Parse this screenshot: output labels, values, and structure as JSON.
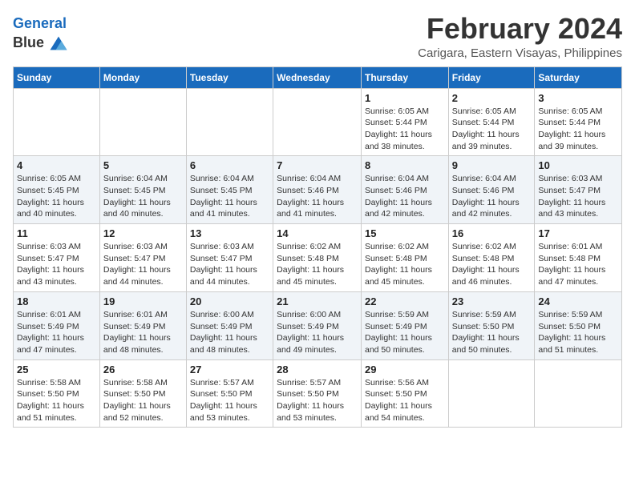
{
  "header": {
    "logo_line1": "General",
    "logo_line2": "Blue",
    "month": "February 2024",
    "location": "Carigara, Eastern Visayas, Philippines"
  },
  "weekdays": [
    "Sunday",
    "Monday",
    "Tuesday",
    "Wednesday",
    "Thursday",
    "Friday",
    "Saturday"
  ],
  "weeks": [
    [
      {
        "day": "",
        "info": ""
      },
      {
        "day": "",
        "info": ""
      },
      {
        "day": "",
        "info": ""
      },
      {
        "day": "",
        "info": ""
      },
      {
        "day": "1",
        "info": "Sunrise: 6:05 AM\nSunset: 5:44 PM\nDaylight: 11 hours\nand 38 minutes."
      },
      {
        "day": "2",
        "info": "Sunrise: 6:05 AM\nSunset: 5:44 PM\nDaylight: 11 hours\nand 39 minutes."
      },
      {
        "day": "3",
        "info": "Sunrise: 6:05 AM\nSunset: 5:44 PM\nDaylight: 11 hours\nand 39 minutes."
      }
    ],
    [
      {
        "day": "4",
        "info": "Sunrise: 6:05 AM\nSunset: 5:45 PM\nDaylight: 11 hours\nand 40 minutes."
      },
      {
        "day": "5",
        "info": "Sunrise: 6:04 AM\nSunset: 5:45 PM\nDaylight: 11 hours\nand 40 minutes."
      },
      {
        "day": "6",
        "info": "Sunrise: 6:04 AM\nSunset: 5:45 PM\nDaylight: 11 hours\nand 41 minutes."
      },
      {
        "day": "7",
        "info": "Sunrise: 6:04 AM\nSunset: 5:46 PM\nDaylight: 11 hours\nand 41 minutes."
      },
      {
        "day": "8",
        "info": "Sunrise: 6:04 AM\nSunset: 5:46 PM\nDaylight: 11 hours\nand 42 minutes."
      },
      {
        "day": "9",
        "info": "Sunrise: 6:04 AM\nSunset: 5:46 PM\nDaylight: 11 hours\nand 42 minutes."
      },
      {
        "day": "10",
        "info": "Sunrise: 6:03 AM\nSunset: 5:47 PM\nDaylight: 11 hours\nand 43 minutes."
      }
    ],
    [
      {
        "day": "11",
        "info": "Sunrise: 6:03 AM\nSunset: 5:47 PM\nDaylight: 11 hours\nand 43 minutes."
      },
      {
        "day": "12",
        "info": "Sunrise: 6:03 AM\nSunset: 5:47 PM\nDaylight: 11 hours\nand 44 minutes."
      },
      {
        "day": "13",
        "info": "Sunrise: 6:03 AM\nSunset: 5:47 PM\nDaylight: 11 hours\nand 44 minutes."
      },
      {
        "day": "14",
        "info": "Sunrise: 6:02 AM\nSunset: 5:48 PM\nDaylight: 11 hours\nand 45 minutes."
      },
      {
        "day": "15",
        "info": "Sunrise: 6:02 AM\nSunset: 5:48 PM\nDaylight: 11 hours\nand 45 minutes."
      },
      {
        "day": "16",
        "info": "Sunrise: 6:02 AM\nSunset: 5:48 PM\nDaylight: 11 hours\nand 46 minutes."
      },
      {
        "day": "17",
        "info": "Sunrise: 6:01 AM\nSunset: 5:48 PM\nDaylight: 11 hours\nand 47 minutes."
      }
    ],
    [
      {
        "day": "18",
        "info": "Sunrise: 6:01 AM\nSunset: 5:49 PM\nDaylight: 11 hours\nand 47 minutes."
      },
      {
        "day": "19",
        "info": "Sunrise: 6:01 AM\nSunset: 5:49 PM\nDaylight: 11 hours\nand 48 minutes."
      },
      {
        "day": "20",
        "info": "Sunrise: 6:00 AM\nSunset: 5:49 PM\nDaylight: 11 hours\nand 48 minutes."
      },
      {
        "day": "21",
        "info": "Sunrise: 6:00 AM\nSunset: 5:49 PM\nDaylight: 11 hours\nand 49 minutes."
      },
      {
        "day": "22",
        "info": "Sunrise: 5:59 AM\nSunset: 5:49 PM\nDaylight: 11 hours\nand 50 minutes."
      },
      {
        "day": "23",
        "info": "Sunrise: 5:59 AM\nSunset: 5:50 PM\nDaylight: 11 hours\nand 50 minutes."
      },
      {
        "day": "24",
        "info": "Sunrise: 5:59 AM\nSunset: 5:50 PM\nDaylight: 11 hours\nand 51 minutes."
      }
    ],
    [
      {
        "day": "25",
        "info": "Sunrise: 5:58 AM\nSunset: 5:50 PM\nDaylight: 11 hours\nand 51 minutes."
      },
      {
        "day": "26",
        "info": "Sunrise: 5:58 AM\nSunset: 5:50 PM\nDaylight: 11 hours\nand 52 minutes."
      },
      {
        "day": "27",
        "info": "Sunrise: 5:57 AM\nSunset: 5:50 PM\nDaylight: 11 hours\nand 53 minutes."
      },
      {
        "day": "28",
        "info": "Sunrise: 5:57 AM\nSunset: 5:50 PM\nDaylight: 11 hours\nand 53 minutes."
      },
      {
        "day": "29",
        "info": "Sunrise: 5:56 AM\nSunset: 5:50 PM\nDaylight: 11 hours\nand 54 minutes."
      },
      {
        "day": "",
        "info": ""
      },
      {
        "day": "",
        "info": ""
      }
    ]
  ]
}
